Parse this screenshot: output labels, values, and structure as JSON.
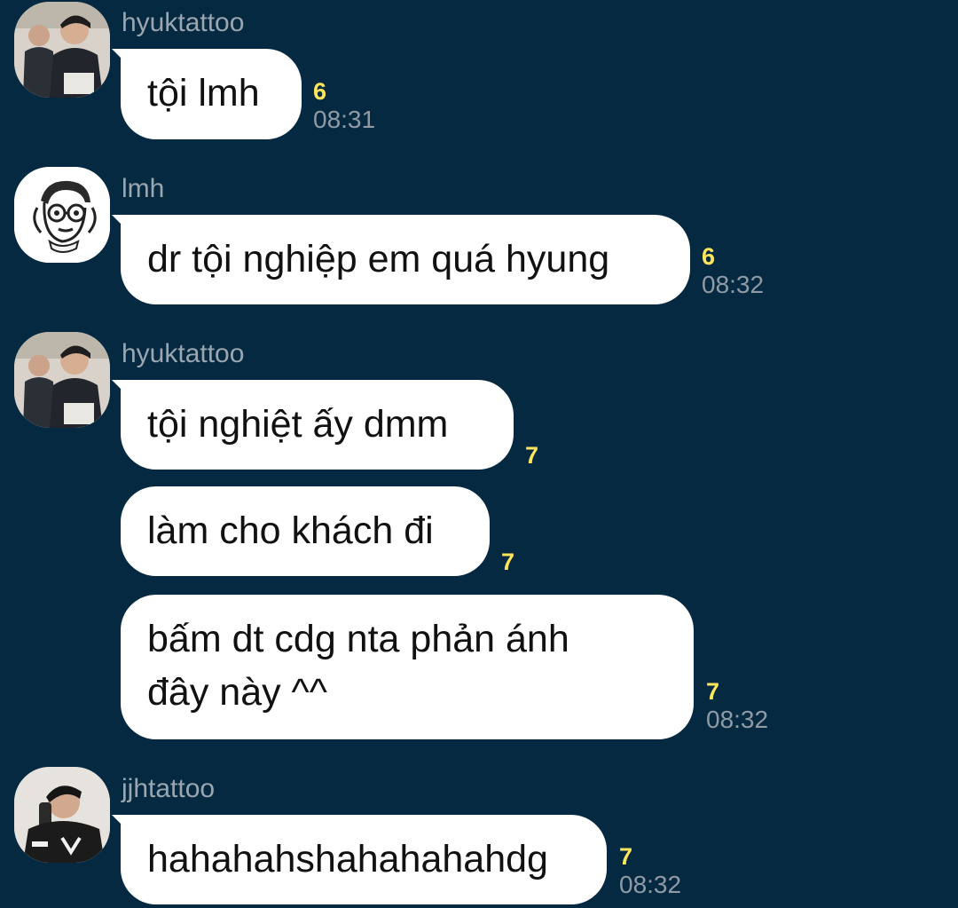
{
  "messages": [
    {
      "sender": "hyuktattoo",
      "avatar": "photo-avatar-two-men",
      "bubbles": [
        {
          "text": "tội lmh",
          "unread": "6",
          "time": "08:31"
        }
      ]
    },
    {
      "sender": "lmh",
      "avatar": "cartoon-glasses-avatar",
      "bubbles": [
        {
          "text": "dr tội nghiệp em quá hyung",
          "unread": "6",
          "time": "08:32"
        }
      ]
    },
    {
      "sender": "hyuktattoo",
      "avatar": "photo-avatar-two-men",
      "bubbles": [
        {
          "text": "tội nghiệt ấy dmm",
          "unread": "7",
          "time": ""
        },
        {
          "text": "làm cho khách đi",
          "unread": "7",
          "time": ""
        },
        {
          "text": "bấm dt cdg nta phản ánh\nđây này ^^",
          "unread": "7",
          "time": "08:32"
        }
      ]
    },
    {
      "sender": "jjhtattoo",
      "avatar": "photo-avatar-phone-man",
      "bubbles": [
        {
          "text": "hahahahshahahahahdg",
          "unread": "7",
          "time": "08:32"
        }
      ]
    }
  ],
  "colors": {
    "background": "#052941",
    "bubble": "#ffffff",
    "unread": "#ffe55a",
    "time": "#8f9aa4",
    "sender": "#9aa6b0"
  }
}
